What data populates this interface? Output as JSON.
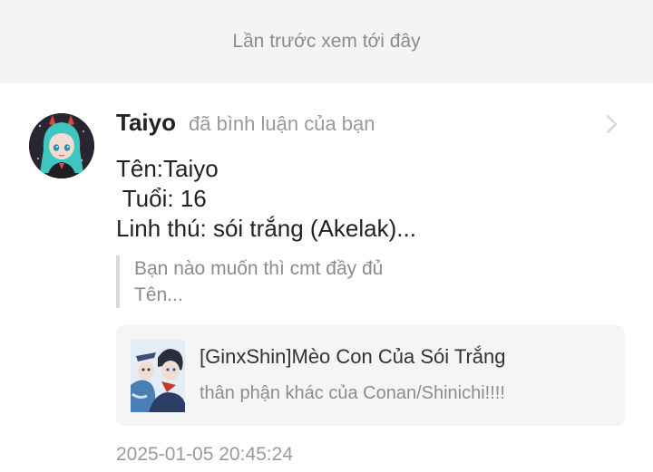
{
  "banner": {
    "text": "Lần trước xem tới đây"
  },
  "comment": {
    "username": "Taiyo",
    "action": "đã bình luận của bạn",
    "body_lines": [
      "Tên:Taiyo",
      " Tuổi: 16",
      "Linh thú: sói trắng (Akelak)..."
    ],
    "quote_lines": [
      "Bạn nào muốn thì cmt đầy đủ",
      "Tên..."
    ],
    "story": {
      "title": "[GinxShin]Mèo Con Của Sói Trắng",
      "description": "thân phận khác của Conan/Shinichi!!!!"
    },
    "timestamp": "2025-01-05 20:45:24",
    "icons": {
      "chevron": "chevron-right-icon"
    }
  }
}
